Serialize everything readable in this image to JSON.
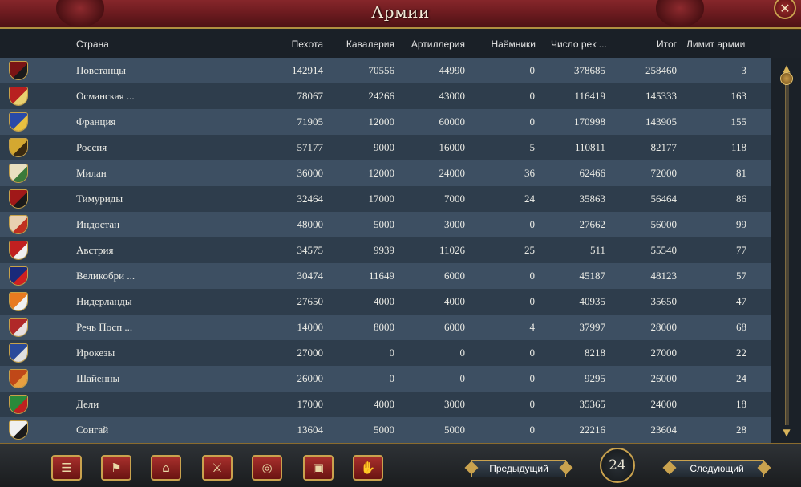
{
  "window": {
    "title": "Армии",
    "close_icon": "close-icon"
  },
  "columns": {
    "country": "Страна",
    "infantry": "Пехота",
    "cavalry": "Кавалерия",
    "artillery": "Артиллерия",
    "mercenaries": "Наёмники",
    "recruits": "Число рек ...",
    "total": "Итог",
    "army_limit": "Лимит армии"
  },
  "rows": [
    {
      "name": "Повстанцы",
      "infantry": "142914",
      "cavalry": "70556",
      "artillery": "44990",
      "mercenaries": "0",
      "recruits": "378685",
      "total": "258460",
      "limit": "3",
      "flag": "#7a1414",
      "flag2": "#1a1a1a"
    },
    {
      "name": "Османская ...",
      "infantry": "78067",
      "cavalry": "24266",
      "artillery": "43000",
      "mercenaries": "0",
      "recruits": "116419",
      "total": "145333",
      "limit": "163",
      "flag": "#b82020",
      "flag2": "#e8d070"
    },
    {
      "name": "Франция",
      "infantry": "71905",
      "cavalry": "12000",
      "artillery": "60000",
      "mercenaries": "0",
      "recruits": "170998",
      "total": "143905",
      "limit": "155",
      "flag": "#2a4aa8",
      "flag2": "#e8c040"
    },
    {
      "name": "Россия",
      "infantry": "57177",
      "cavalry": "9000",
      "artillery": "16000",
      "mercenaries": "5",
      "recruits": "110811",
      "total": "82177",
      "limit": "118",
      "flag": "#d4a830",
      "flag2": "#3a2a10"
    },
    {
      "name": "Милан",
      "infantry": "36000",
      "cavalry": "12000",
      "artillery": "24000",
      "mercenaries": "36",
      "recruits": "62466",
      "total": "72000",
      "limit": "81",
      "flag": "#e8e0c0",
      "flag2": "#3a7a3a"
    },
    {
      "name": "Тимуриды",
      "infantry": "32464",
      "cavalry": "17000",
      "artillery": "7000",
      "mercenaries": "24",
      "recruits": "35863",
      "total": "56464",
      "limit": "86",
      "flag": "#a01818",
      "flag2": "#1a1a1a"
    },
    {
      "name": "Индостан",
      "infantry": "48000",
      "cavalry": "5000",
      "artillery": "3000",
      "mercenaries": "0",
      "recruits": "27662",
      "total": "56000",
      "limit": "99",
      "flag": "#e8d0b0",
      "flag2": "#c03020"
    },
    {
      "name": "Австрия",
      "infantry": "34575",
      "cavalry": "9939",
      "artillery": "11026",
      "mercenaries": "25",
      "recruits": "511",
      "total": "55540",
      "limit": "77",
      "flag": "#c02020",
      "flag2": "#f0f0f0"
    },
    {
      "name": "Великобри ...",
      "infantry": "30474",
      "cavalry": "11649",
      "artillery": "6000",
      "mercenaries": "0",
      "recruits": "45187",
      "total": "48123",
      "limit": "57",
      "flag": "#1a2a7a",
      "flag2": "#d02020"
    },
    {
      "name": "Нидерланды",
      "infantry": "27650",
      "cavalry": "4000",
      "artillery": "4000",
      "mercenaries": "0",
      "recruits": "40935",
      "total": "35650",
      "limit": "47",
      "flag": "#e87a20",
      "flag2": "#f0f0f0"
    },
    {
      "name": "Речь Посп ...",
      "infantry": "14000",
      "cavalry": "8000",
      "artillery": "6000",
      "mercenaries": "4",
      "recruits": "37997",
      "total": "28000",
      "limit": "68",
      "flag": "#b02828",
      "flag2": "#e8e0e0"
    },
    {
      "name": "Ирокезы",
      "infantry": "27000",
      "cavalry": "0",
      "artillery": "0",
      "mercenaries": "0",
      "recruits": "8218",
      "total": "27000",
      "limit": "22",
      "flag": "#2a4a9a",
      "flag2": "#e0e0e0"
    },
    {
      "name": "Шайенны",
      "infantry": "26000",
      "cavalry": "0",
      "artillery": "0",
      "mercenaries": "0",
      "recruits": "9295",
      "total": "26000",
      "limit": "24",
      "flag": "#c04818",
      "flag2": "#e8a040"
    },
    {
      "name": "Дели",
      "infantry": "17000",
      "cavalry": "4000",
      "artillery": "3000",
      "mercenaries": "0",
      "recruits": "35365",
      "total": "24000",
      "limit": "18",
      "flag": "#2a8a3a",
      "flag2": "#c02020"
    },
    {
      "name": "Сонгай",
      "infantry": "13604",
      "cavalry": "5000",
      "artillery": "5000",
      "mercenaries": "0",
      "recruits": "22216",
      "total": "23604",
      "limit": "28",
      "flag": "#f0f0f0",
      "flag2": "#1a1a1a"
    }
  ],
  "toolbar": {
    "icons": [
      "ledger-icon",
      "flag-icon",
      "buildings-icon",
      "crossed-swords-icon",
      "coins-icon",
      "trade-goods-icon",
      "handshake-icon"
    ]
  },
  "pagination": {
    "prev_label": "Предыдущий",
    "page": "24",
    "next_label": "Следующий"
  },
  "colors": {
    "title_bar": "#6e1c20",
    "row_odd": "#3d4f62",
    "row_even": "#2e3d4c",
    "accent_gold": "#c9a24e"
  }
}
